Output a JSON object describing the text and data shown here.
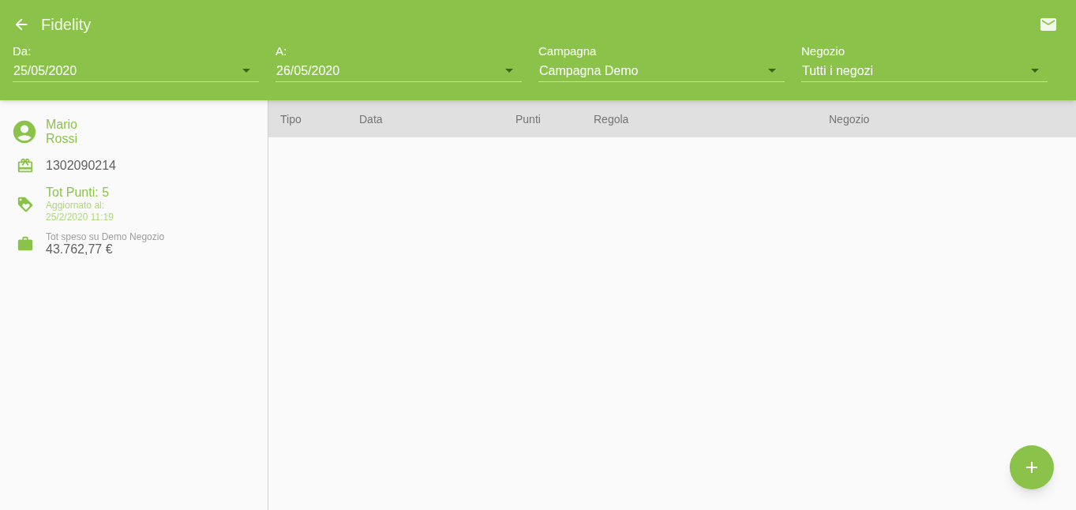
{
  "app_bar": {
    "title": "Fidelity"
  },
  "filters": [
    {
      "label": "Da:",
      "value": "25/05/2020"
    },
    {
      "label": "A:",
      "value": "26/05/2020"
    },
    {
      "label": "Campagna",
      "value": "Campagna Demo"
    },
    {
      "label": "Negozio",
      "value": "Tutti i negozi"
    }
  ],
  "customer": {
    "first_name": "Mario",
    "last_name": "Rossi",
    "card_number": "1302090214",
    "points": "Tot Punti: 5",
    "updated_label": "Aggiornato al:",
    "updated_at": "25/2/2020 11:19",
    "spent_label": "Tot speso su Demo Negozio",
    "spent_value": "43.762,77 €"
  },
  "table": {
    "columns": [
      "Tipo",
      "Data",
      "Punti",
      "Regola",
      "Negozio"
    ]
  }
}
